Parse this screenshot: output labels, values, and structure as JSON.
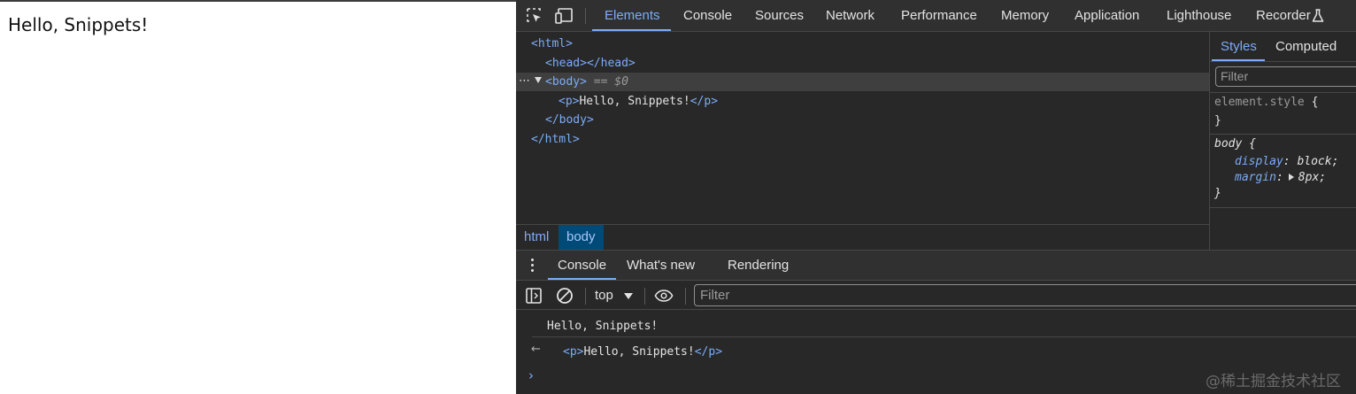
{
  "page": {
    "text": "Hello, Snippets!"
  },
  "devtools": {
    "toolbar": {
      "inspect_icon": "element-picker-icon",
      "device_icon": "device-toolbar-icon",
      "tabs": [
        "Elements",
        "Console",
        "Sources",
        "Network",
        "Performance",
        "Memory",
        "Application",
        "Lighthouse",
        "Recorder"
      ],
      "active_tab": "Elements",
      "recorder_icon": "flask-icon"
    },
    "elements": {
      "tree": {
        "html_open": "<html>",
        "head": "<head></head>",
        "body_open": "<body>",
        "body_suffix": "== $0",
        "p_open": "<p>",
        "p_text": "Hello, Snippets!",
        "p_close": "</p>",
        "body_close": "</body>",
        "html_close": "</html>",
        "dots": "⋯"
      },
      "breadcrumbs": [
        "html",
        "body"
      ]
    },
    "styles": {
      "tabs": [
        "Styles",
        "Computed"
      ],
      "filter_placeholder": "Filter",
      "element_style_selector": "element.style",
      "open_brace": "{",
      "close_brace": "}",
      "body_rule": {
        "selector": "body",
        "properties": [
          {
            "name": "display",
            "value": "block;"
          },
          {
            "name": "margin",
            "value": "8px;"
          }
        ]
      }
    },
    "drawer": {
      "tabs": [
        "Console",
        "What's new",
        "Rendering"
      ],
      "active_tab": "Console",
      "context": "top",
      "filter_placeholder": "Filter",
      "logs": {
        "message": "Hello, Snippets!",
        "return_open": "<p>",
        "return_text": "Hello, Snippets!",
        "return_close": "</p>"
      },
      "prompt": "›"
    },
    "watermark": "@稀土掘金技术社区"
  },
  "colors": {
    "accent": "#7cacf8",
    "panel": "#282828",
    "toolbar": "#303030",
    "breadcrumb_active": "#004a77"
  }
}
